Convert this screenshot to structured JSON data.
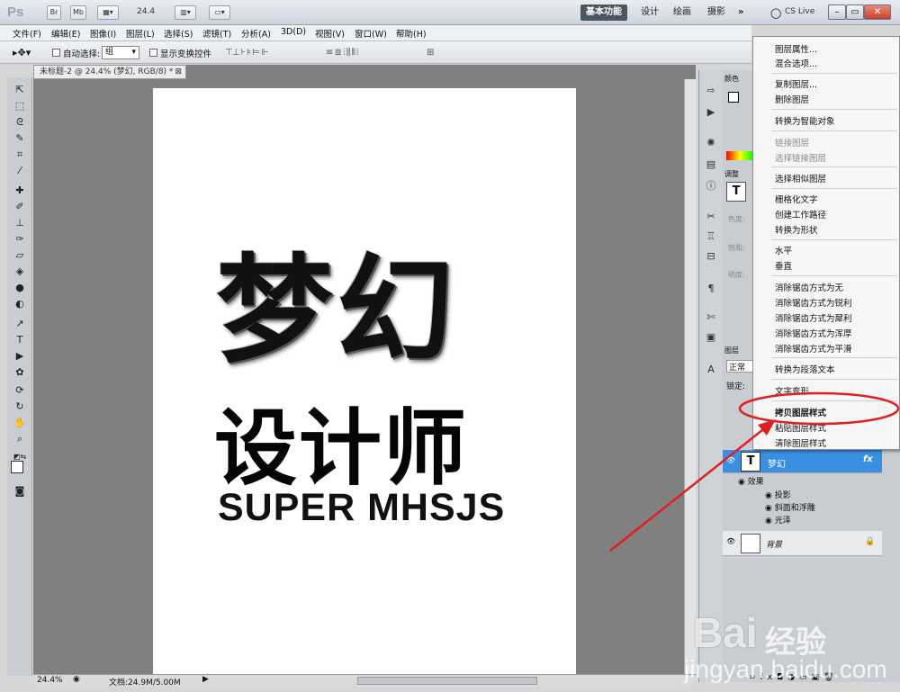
{
  "titlebar": {
    "logo": "Ps",
    "btn_br": "Br",
    "btn_mb": "Mb",
    "zoom": "24.4",
    "workspaces": [
      "基本功能",
      "设计",
      "绘画",
      "摄影"
    ],
    "more": "»",
    "cslive": "CS Live"
  },
  "menu": [
    "文件(F)",
    "编辑(E)",
    "图像(I)",
    "图层(L)",
    "选择(S)",
    "滤镜(T)",
    "分析(A)",
    "3D(D)",
    "视图(V)",
    "窗口(W)",
    "帮助(H)"
  ],
  "options": {
    "auto_select_label": "自动选择:",
    "auto_select_value": "组",
    "show_transform_label": "显示变换控件"
  },
  "document": {
    "tab_title": "未标题-2 @ 24.4% (梦幻, RGB/8) *",
    "zoom": "24.4%",
    "doc_size": "文档:24.9M/5.00M",
    "text_dream": "梦幻",
    "text_designer": "设计师",
    "text_super": "SUPER MHSJS"
  },
  "panels": {
    "color_tab": "颜色",
    "adjust_tab": "调整",
    "layers_tab": "图层",
    "blend_mode": "正常",
    "lock_label": "锁定:",
    "adjust_labels": [
      "色度:",
      "饱和:",
      "明度:"
    ]
  },
  "layers": {
    "selected_layer": "梦幻",
    "effects_label": "效果",
    "effects": [
      "投影",
      "斜面和浮雕",
      "光泽"
    ],
    "background": "背景",
    "fx": "fx"
  },
  "context_menu": [
    {
      "label": "图层属性...",
      "disabled": false
    },
    {
      "label": "混合选项...",
      "disabled": false
    },
    {
      "label": "复制图层...",
      "disabled": false
    },
    {
      "label": "删除图层",
      "disabled": false
    },
    {
      "label": "转换为智能对象",
      "disabled": false
    },
    {
      "label": "链接图层",
      "disabled": true
    },
    {
      "label": "选择链接图层",
      "disabled": true
    },
    {
      "label": "选择相似图层",
      "disabled": false
    },
    {
      "label": "栅格化文字",
      "disabled": false
    },
    {
      "label": "创建工作路径",
      "disabled": false
    },
    {
      "label": "转换为形状",
      "disabled": false
    },
    {
      "label": "水平",
      "disabled": false
    },
    {
      "label": "垂直",
      "disabled": false
    },
    {
      "label": "消除锯齿方式为无",
      "disabled": false
    },
    {
      "label": "消除锯齿方式为锐利",
      "disabled": false
    },
    {
      "label": "消除锯齿方式为犀利",
      "disabled": false
    },
    {
      "label": "消除锯齿方式为浑厚",
      "disabled": false
    },
    {
      "label": "消除锯齿方式为平滑",
      "disabled": false
    },
    {
      "label": "转换为段落文本",
      "disabled": false
    },
    {
      "label": "文字变形...",
      "disabled": false
    },
    {
      "label": "拷贝图层样式",
      "disabled": false
    },
    {
      "label": "粘贴图层样式",
      "disabled": false
    },
    {
      "label": "清除图层样式",
      "disabled": false
    }
  ],
  "watermark": {
    "brand": "Bai",
    "brand2": "经验",
    "url": "jingyan.baidu.com"
  },
  "colors": {
    "accent": "#3a8fe0",
    "annotation": "#e02020"
  }
}
